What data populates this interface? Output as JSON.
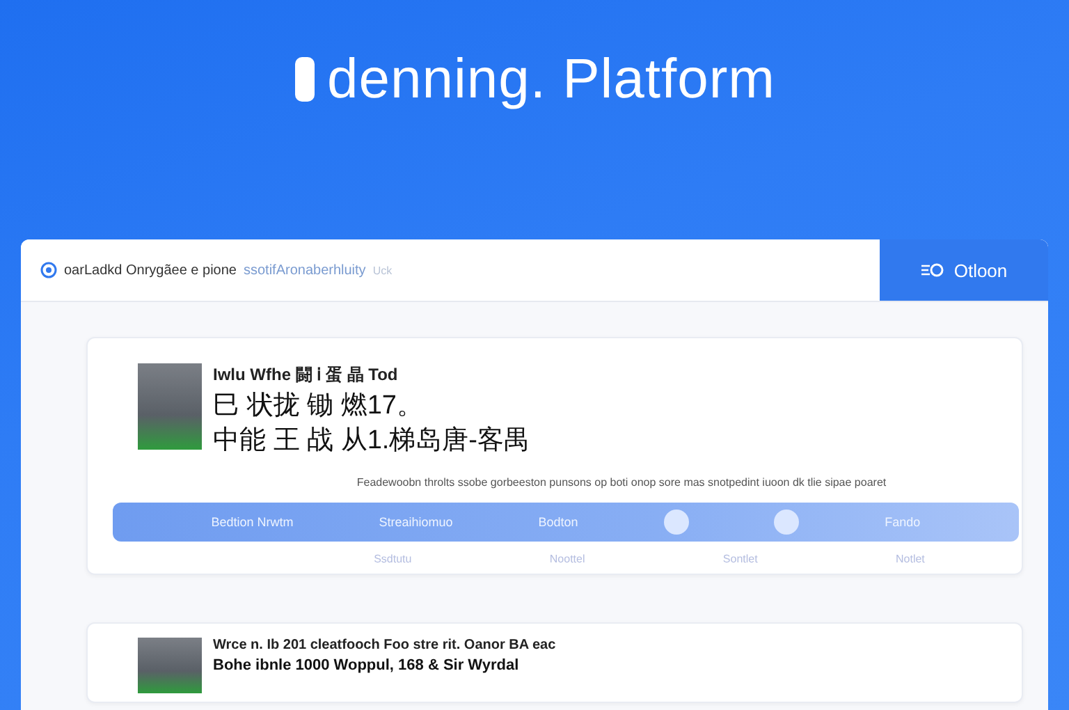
{
  "hero": {
    "title": "denning. Platform"
  },
  "panel": {
    "breadcrumb": "oarLadkd Onrygãee e pione",
    "breadcrumb_hint": "ssotifAronaberhluity",
    "breadcrumb_extra": "Uck",
    "action": "Otloon"
  },
  "courses": [
    {
      "meta": "Iwlu Wfhe 闘 ⅰ 蛋 晶 Tod",
      "headline": [
        "巳 状拢 锄 燃17。",
        "中能 王 战 从1.梯岛唐-客禺"
      ],
      "description": "Feadewoobn throlts ssobe gorbeeston punsons op boti onop sore mas snotpedint iuoon dk tlie sipae poaret",
      "bar": [
        "Bedtion Nrwtm",
        "Streaihiomuo",
        "Bodton",
        "Fando"
      ],
      "footer": [
        "Ssdtutu",
        "Noottel",
        "Sontlet",
        "Notlet"
      ]
    },
    {
      "meta": "Wrce n. Ib 201 cleatfooch Foo stre rit. Oanor BA eac",
      "headline": [
        "Bohe ibnle 1000 Woppul, 168 & Sir Wyrdal"
      ]
    }
  ]
}
